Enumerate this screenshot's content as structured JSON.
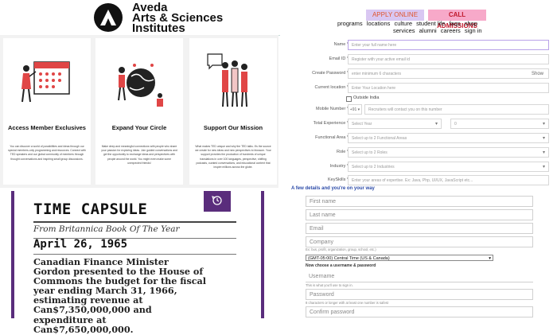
{
  "brand": {
    "line1": "Aveda",
    "line2": "Arts & Sciences",
    "line3": "Institutes"
  },
  "header_buttons": {
    "apply": "APPLY ONLINE",
    "call": "CALL ADMISSIONS"
  },
  "nav": {
    "row1": [
      "programs",
      "locations",
      "culture",
      "student life",
      "faqs",
      "shop"
    ],
    "row2": [
      "services",
      "alumni",
      "careers",
      "sign in"
    ]
  },
  "cards": [
    {
      "title": "Access Member Exclusives",
      "icon": "calendar-icon",
      "text": "You can discover a world of possibilities and ideas through our special members-only programming and resources. Connect with TED speakers and our global community of members through thought conversations and inspiring small group discussions."
    },
    {
      "title": "Expand Your Circle",
      "icon": "globe-people-icon",
      "text": "Make deep and meaningful connections with people who share your passion for exploring ideas. Join guided conversations and get the opportunity to exchange ideas and perspectives with people around the world. You might even make some unexpected friends!"
    },
    {
      "title": "Support Our Mission",
      "icon": "group-speech-icon",
      "text": "What makes TED unique and why the TED talks. It's the source we create for new ideas and new perspectives to blossom. Your support provides the production of hundreds of unique translations in over 100 languages, perspective, shifting podcasts, curated conversations, and educational content that inspire millions across the globe."
    }
  ],
  "form": {
    "name": {
      "label": "Name",
      "placeholder": "Enter your full name here"
    },
    "email": {
      "label": "Email ID",
      "placeholder": "Register with your active email id"
    },
    "password": {
      "label": "Create Password",
      "placeholder": "enter minimum 6 characters",
      "show": "Show"
    },
    "location": {
      "label": "Current location",
      "placeholder": "Enter Your Location here",
      "outside": "Outside India"
    },
    "mobile": {
      "label": "Mobile Number",
      "code": "+91",
      "placeholder": "Recruiters will contact you on this number"
    },
    "experience": {
      "label": "Total Experience",
      "year": "Select Year",
      "month": "0"
    },
    "functional": {
      "label": "Functional Area",
      "placeholder": "Select up to 2 Functional Areas"
    },
    "role": {
      "label": "Role",
      "placeholder": "Select up to 2 Roles"
    },
    "industry": {
      "label": "Industry",
      "placeholder": "Select up to 2 Industries"
    },
    "keyskills": {
      "label": "KeySkills",
      "placeholder": "Enter your areas of expertise. Ex: Java, Php, UI/UX, JavaScript etc..."
    }
  },
  "article": {
    "title": "TIME CAPSULE",
    "subtitle": "From Britannica Book Of The Year",
    "date": "April 26, 1965",
    "body": [
      "Canadian Finance Minister",
      "Gordon presented to the House of",
      "Commons the budget for the fiscal",
      "year ending March 31, 1966,",
      "estimating revenue at",
      "Can$7,350,000,000 and",
      "expenditure at",
      "Can$7,650,000,000."
    ]
  },
  "signup": {
    "heading": "A few details and you're on your way",
    "first_name": "First name",
    "last_name": "Last name",
    "email": "Email",
    "company": "Company",
    "company_hint": "Ex: bus, profit, organization, group, school, etc.)",
    "timezone": "(GMT-05:00) Central Time (US & Canada)",
    "section": "Now choose a username & password",
    "username": "Username",
    "username_hint": "This is what you'll use to sign in.",
    "password": "Password",
    "password_hint": "8 characters or longer with at least one number is safest",
    "confirm": "Confirm password"
  },
  "colors": {
    "accent_purple": "#5a2d7c",
    "apply_bg": "#d9c7f2",
    "call_bg": "#f7a9c9",
    "link_blue": "#2b4aa8"
  }
}
